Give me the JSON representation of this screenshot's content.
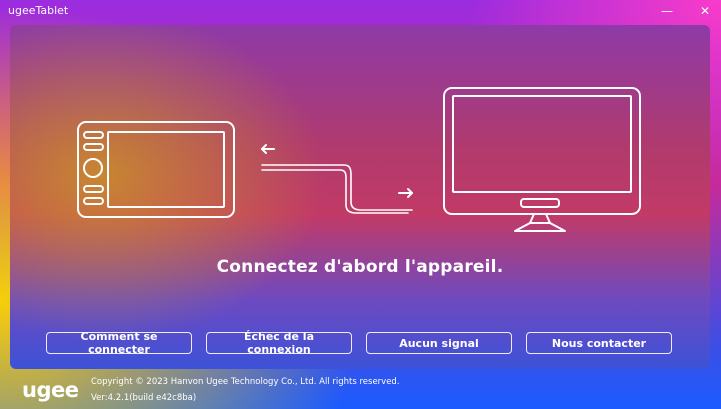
{
  "window": {
    "title": "ugeeTablet",
    "minimize_symbol": "—",
    "close_symbol": "✕"
  },
  "main": {
    "message": "Connectez d'abord l'appareil."
  },
  "buttons": [
    {
      "label": "Comment se connecter"
    },
    {
      "label": "Échec de la connexion"
    },
    {
      "label": "Aucun signal"
    },
    {
      "label": "Nous contacter"
    }
  ],
  "footer": {
    "brand": "ugee",
    "copyright": "Copyright © 2023 Hanvon Ugee Technology Co., Ltd. All rights reserved.",
    "version": "Ver:4.2.1(build e42c8ba)"
  },
  "icons": [
    "tablet-icon",
    "monitor-icon",
    "cable-icon",
    "arrow-left-icon",
    "arrow-right-icon"
  ],
  "colors": {
    "accent_blue": "#1b5cff",
    "accent_pink": "#c72a9a",
    "accent_yellow": "#ffd600"
  }
}
